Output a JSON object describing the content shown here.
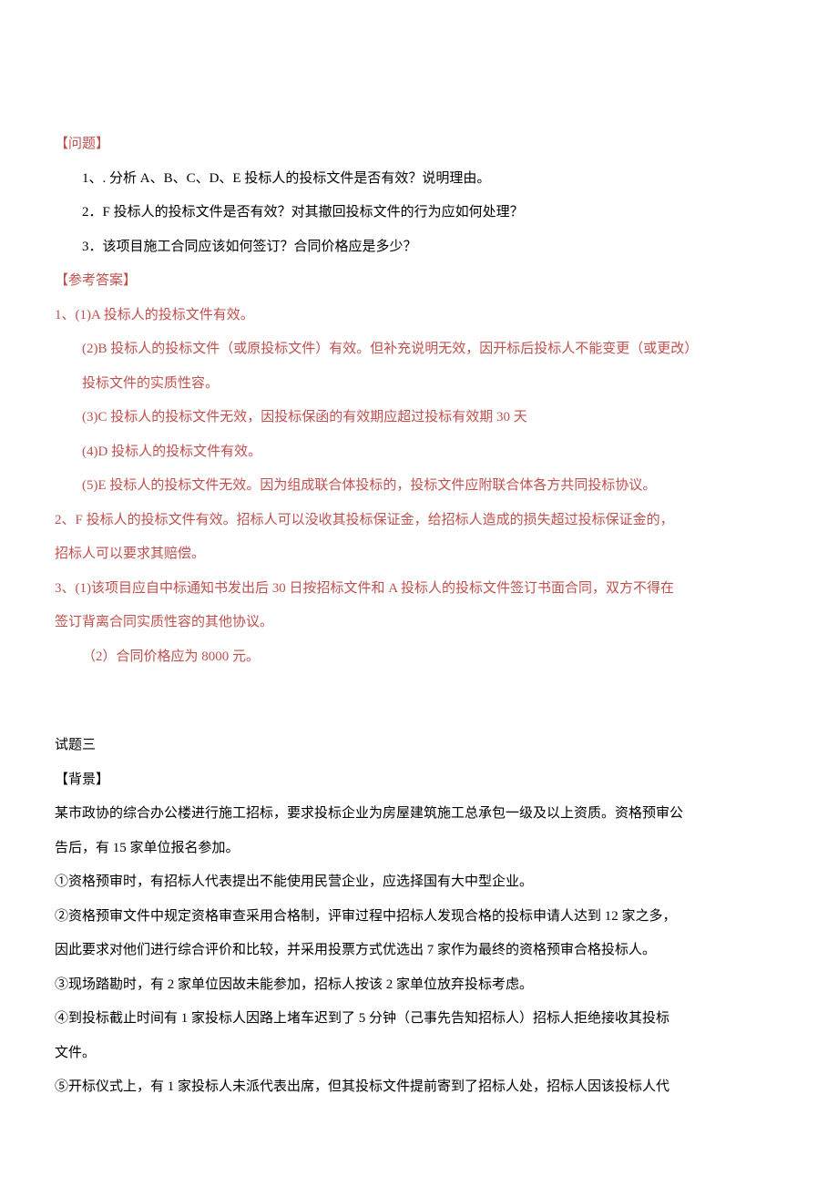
{
  "q_header": "【问题】",
  "q1": "1、. 分析 A、B、C、D、E 投标人的投标文件是否有效？说明理由。",
  "q2": "2．F 投标人的投标文件是否有效？对其撤回投标文件的行为应如何处理？",
  "q3": "3．该项目施工合同应该如何签订？合同价格应是多少？",
  "a_header": "【参考答案】",
  "a1_1": "1、(1)A 投标人的投标文件有效。",
  "a1_2a": "(2)B 投标人的投标文件（或原投标文件）有效。但补充说明无效，因开标后投标人不能变更（或更改）",
  "a1_2b": "投标文件的实质性容。",
  "a1_3": "(3)C 投标人的投标文件无效，因投标保函的有效期应超过投标有效期 30 天",
  "a1_4": "(4)D 投标人的投标文件有效。",
  "a1_5": "(5)E 投标人的投标文件无效。因为组成联合体投标的，投标文件应附联合体各方共同投标协议。",
  "a2a": "2、F 投标人的投标文件有效。招标人可以没收其投标保证金，给招标人造成的损失超过投标保证金的，",
  "a2b": "招标人可以要求其赔偿。",
  "a3a": "3、(1)该项目应自中标通知书发出后 30 日按招标文件和 A 投标人的投标文件签订书面合同，双方不得在",
  "a3b": "签订背离合同实质性容的其他协议。",
  "a3c": "（2）合同价格应为 8000 元。",
  "t3_title": "试题三",
  "t3_bg_header": "【背景】",
  "t3_bg1": "某市政协的综合办公楼进行施工招标，要求投标企业为房屋建筑施工总承包一级及以上资质。资格预审公",
  "t3_bg2": "告后，有 15 家单位报名参加。",
  "t3_p1": " ①资格预审时，有招标人代表提出不能使用民营企业，应选择国有大中型企业。",
  "t3_p2a": " ②资格预审文件中规定资格审查采用合格制，评审过程中招标人发现合格的投标申请人达到 12 家之多，",
  "t3_p2b": "因此要求对他们进行综合评价和比较，并采用投票方式优选出  7 家作为最终的资格预审合格投标人。",
  "t3_p3": " ③现场踏勘时，有 2 家单位因故未能参加，招标人按该 2 家单位放弃投标考虑。",
  "t3_p4a": " ④到投标截止时间有 1 家投标人因路上堵车迟到了 5 分钟（己事先告知招标人）招标人拒绝接收其投标",
  "t3_p4b": "文件。",
  "t3_p5": " ⑤开标仪式上，有 1 家投标人未派代表出席，但其投标文件提前寄到了招标人处，招标人因该投标人代"
}
